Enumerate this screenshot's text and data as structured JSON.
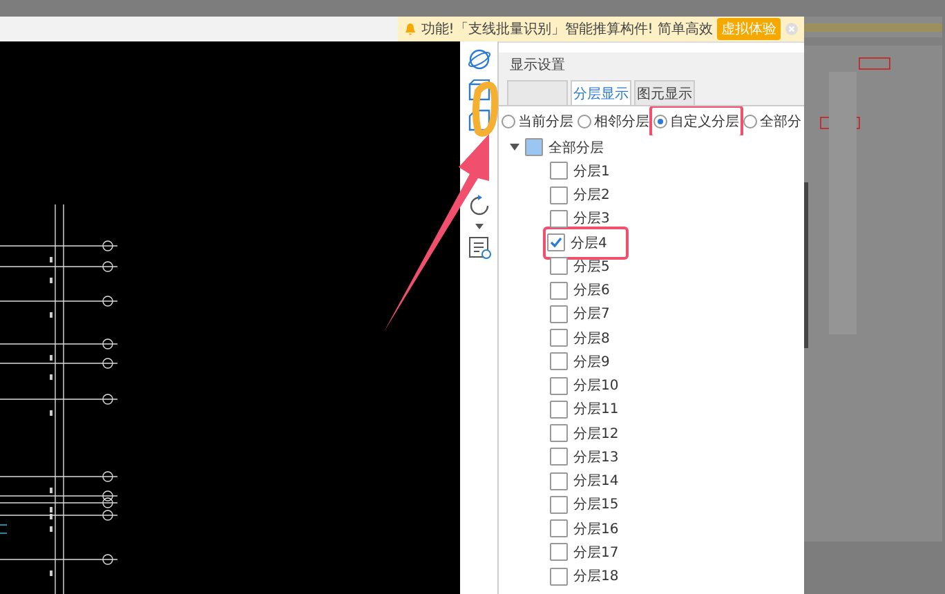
{
  "notice": {
    "text": "功能!「支线批量识别」智能推算构件! 简单高效",
    "button": "虚拟体验"
  },
  "panel": {
    "title": "显示设置",
    "tabs": [
      {
        "selected": false
      },
      {
        "label": "分层显示",
        "selected": true
      },
      {
        "label": "图元显示",
        "selected": false
      }
    ],
    "modes": [
      {
        "label": "当前分层",
        "selected": false
      },
      {
        "label": "相邻分层",
        "selected": false
      },
      {
        "label": "自定义分层",
        "selected": true,
        "highlighted": true
      },
      {
        "label": "全部分",
        "selected": false
      }
    ],
    "tree": {
      "label": "全部分层",
      "expanded": true,
      "partial": true,
      "children": [
        {
          "label": "分层1",
          "checked": false
        },
        {
          "label": "分层2",
          "checked": false
        },
        {
          "label": "分层3",
          "checked": false
        },
        {
          "label": "分层4",
          "checked": true,
          "highlighted": true
        },
        {
          "label": "分层5",
          "checked": false
        },
        {
          "label": "分层6",
          "checked": false
        },
        {
          "label": "分层7",
          "checked": false
        },
        {
          "label": "分层8",
          "checked": false
        },
        {
          "label": "分层9",
          "checked": false
        },
        {
          "label": "分层10",
          "checked": false
        },
        {
          "label": "分层11",
          "checked": false
        },
        {
          "label": "分层12",
          "checked": false
        },
        {
          "label": "分层13",
          "checked": false
        },
        {
          "label": "分层14",
          "checked": false
        },
        {
          "label": "分层15",
          "checked": false
        },
        {
          "label": "分层16",
          "checked": false
        },
        {
          "label": "分层17",
          "checked": false
        },
        {
          "label": "分层18",
          "checked": false
        }
      ]
    }
  }
}
